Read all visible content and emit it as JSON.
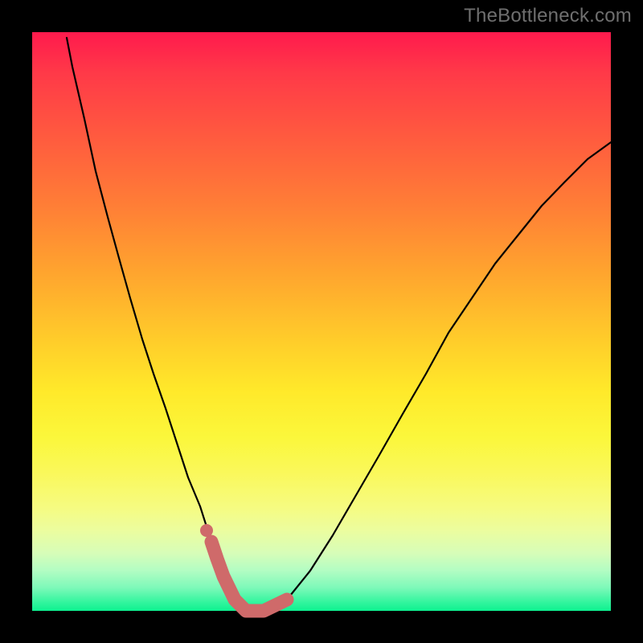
{
  "watermark": "TheBottleneck.com",
  "chart_data": {
    "type": "line",
    "title": "",
    "xlabel": "",
    "ylabel": "",
    "xlim": [
      0,
      100
    ],
    "ylim": [
      0,
      100
    ],
    "grid": false,
    "legend": false,
    "series": [
      {
        "name": "curve",
        "style": "thin-black",
        "x": [
          6,
          7,
          9,
          11,
          13,
          15,
          17,
          19,
          21,
          23,
          25,
          27,
          29,
          31,
          32,
          33,
          35,
          37,
          40,
          44,
          48,
          52,
          56,
          60,
          64,
          68,
          72,
          76,
          80,
          84,
          88,
          92,
          96,
          100
        ],
        "values": [
          99,
          94,
          85,
          76,
          68,
          61,
          54,
          47,
          41,
          35,
          29,
          23,
          18,
          12,
          9,
          6,
          2,
          0,
          0,
          2,
          7,
          13,
          20,
          27,
          34,
          41,
          48,
          54,
          60,
          65,
          70,
          74,
          78,
          81
        ]
      },
      {
        "name": "highlight",
        "style": "thick-red",
        "x": [
          31,
          32,
          33,
          35,
          37,
          40,
          44
        ],
        "values": [
          12,
          9,
          6,
          2,
          0,
          0,
          2
        ]
      },
      {
        "name": "dot",
        "style": "dot-red",
        "x": [
          30
        ],
        "values": [
          14
        ]
      }
    ],
    "colors": {
      "thin": "#000000",
      "highlight": "#cf6a6a",
      "gradient_top": "#ff1a4d",
      "gradient_bottom": "#0df190"
    }
  }
}
